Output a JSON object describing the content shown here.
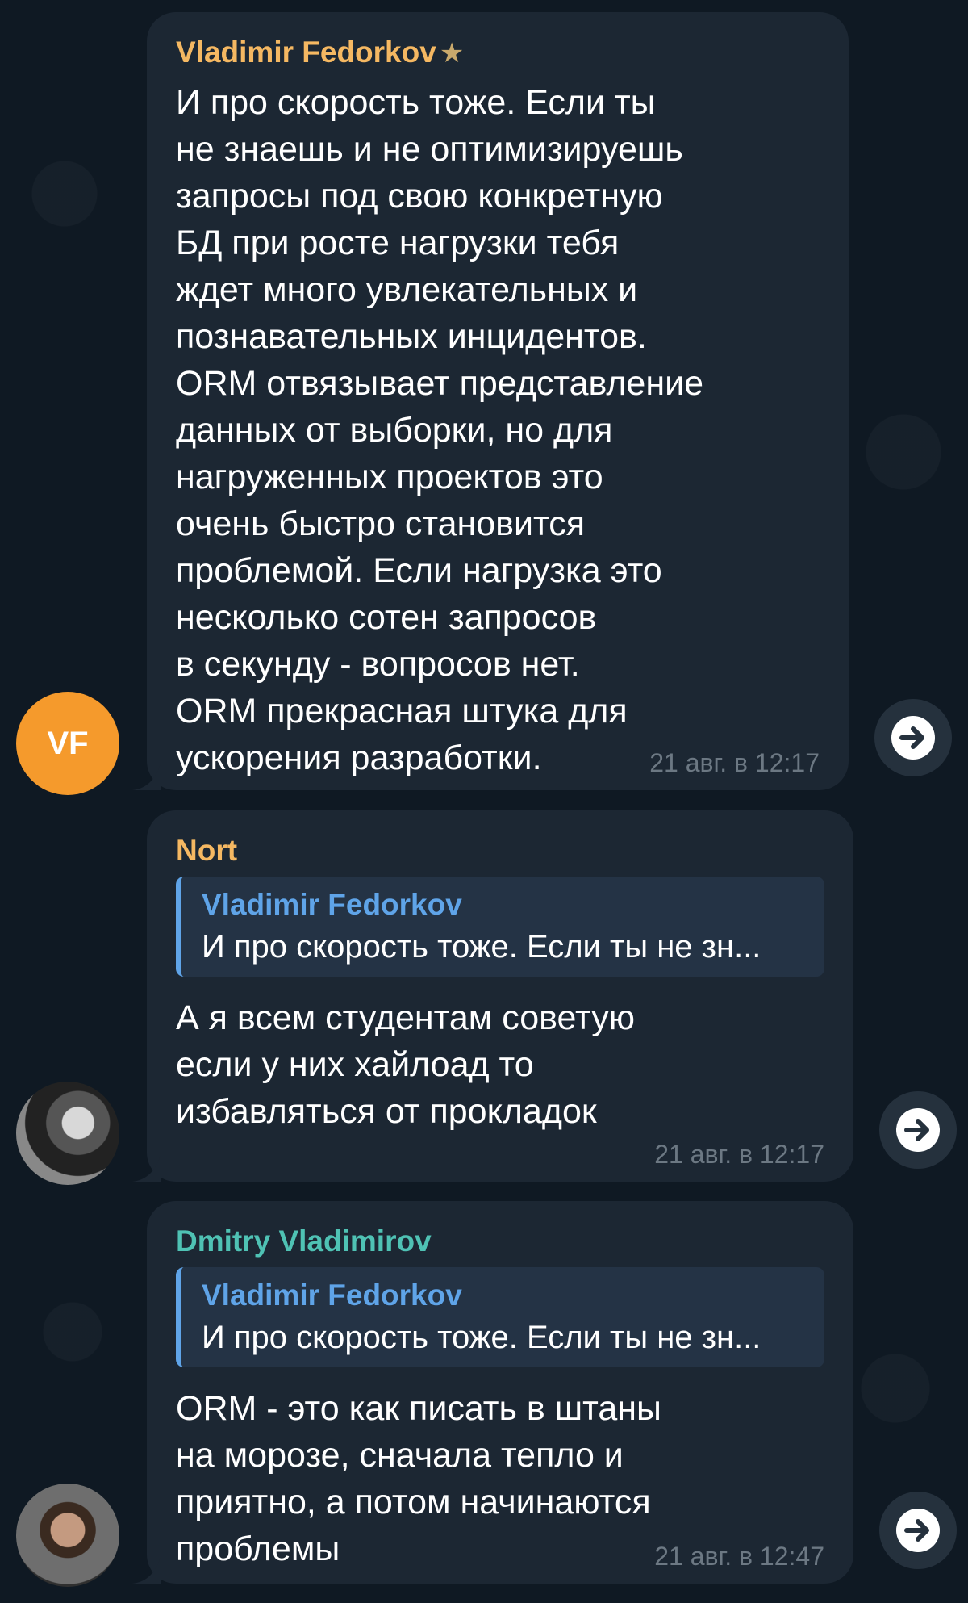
{
  "messages": [
    {
      "author": "Vladimir Fedorkov",
      "author_color": "#f5b862",
      "has_star": true,
      "avatar_initials": "VF",
      "text": "И про скорость тоже. Если ты\nне знаешь и не оптимизируешь\nзапросы под свою конкретную\nБД при росте нагрузки тебя\nждет много увлекательных и\nпознавательных инцидентов.\nORM отвязывает представление\nданных от выборки, но для\nнагруженных проектов это\nочень быстро становится\nпроблемой. Если нагрузка это\nнесколько сотен запросов\nв секунду - вопросов нет.\nORM прекрасная штука для\nускорения разработки.",
      "time": "21 авг. в 12:17"
    },
    {
      "author": "Nort",
      "author_color": "#f5b862",
      "reply": {
        "author": "Vladimir Fedorkov",
        "text": "И про скорость тоже. Если ты не зн..."
      },
      "text": "А я всем студентам советую\nесли у них хайлоад то\nизбавляться от прокладок",
      "time": "21 авг. в 12:17"
    },
    {
      "author": "Dmitry Vladimirov",
      "author_color": "#4fc2b4",
      "reply": {
        "author": "Vladimir Fedorkov",
        "text": "И про скорость тоже. Если ты не зн..."
      },
      "text": "ORM - это как писать в штаны\nна морозе, сначала тепло и\nприятно, а потом начинаются\nпроблемы",
      "time": "21 авг. в 12:47"
    }
  ],
  "icons": {
    "star": "star-icon",
    "share": "share-arrow-icon"
  },
  "colors": {
    "background": "#0f1923",
    "bubble": "#1c2733",
    "reply_accent": "#5fa4e8",
    "time": "#6c7883"
  }
}
